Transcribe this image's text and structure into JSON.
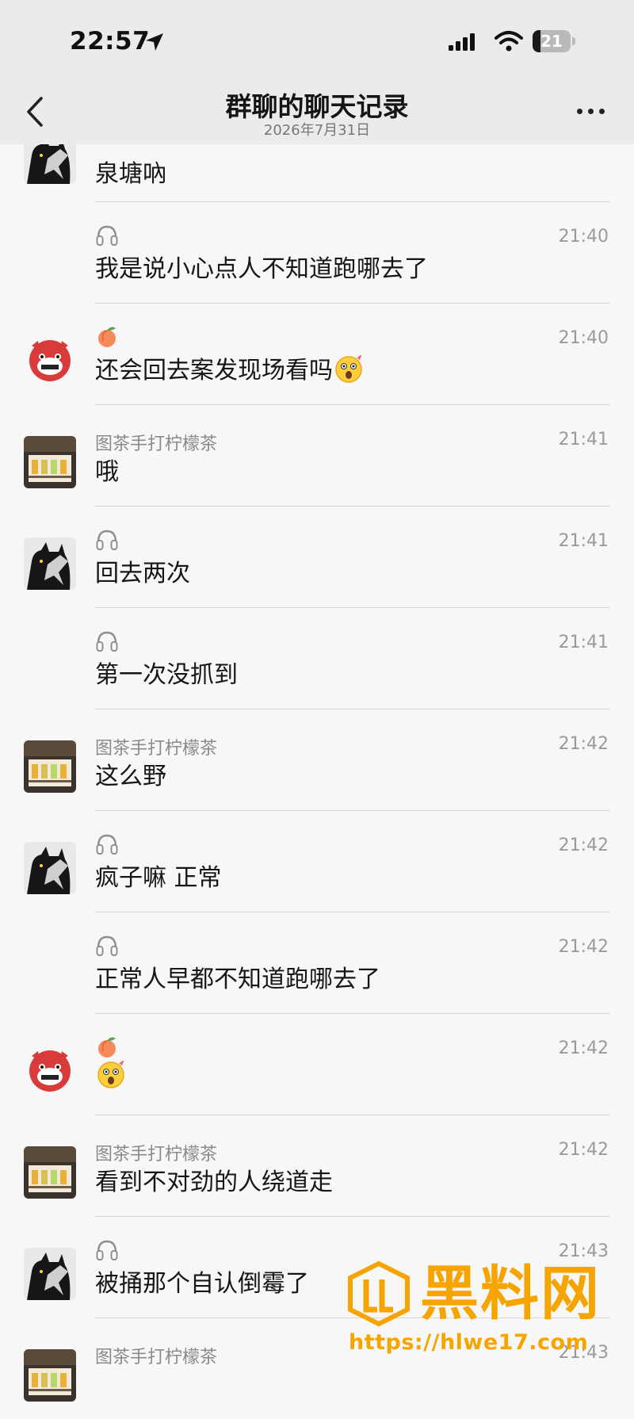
{
  "status_bar": {
    "time": "22:57",
    "battery": "21",
    "battery_level_percent": 21
  },
  "header": {
    "title": "群聊的聊天记录",
    "subtitle": "2026年7月31日"
  },
  "messages": [
    {
      "avatar": "cat-avatar",
      "icon": "",
      "sender": "",
      "time": "",
      "text": "泉塘吶",
      "emoji": ""
    },
    {
      "avatar": "",
      "icon": "headphones-icon",
      "sender": "",
      "time": "21:40",
      "text": "我是说小心点人不知道跑哪去了",
      "emoji": ""
    },
    {
      "avatar": "red-pig-avatar",
      "icon": "peach-icon",
      "sender": "",
      "time": "21:40",
      "text": "还会回去案发现场看吗",
      "emoji": "shocked-face-emoji"
    },
    {
      "avatar": "tea-shop-avatar",
      "icon": "",
      "sender": "图茶手打柠檬茶",
      "time": "21:41",
      "text": "哦",
      "emoji": ""
    },
    {
      "avatar": "cat-avatar",
      "icon": "headphones-icon",
      "sender": "",
      "time": "21:41",
      "text": "回去两次",
      "emoji": ""
    },
    {
      "avatar": "",
      "icon": "headphones-icon",
      "sender": "",
      "time": "21:41",
      "text": "第一次没抓到",
      "emoji": ""
    },
    {
      "avatar": "tea-shop-avatar",
      "icon": "",
      "sender": "图茶手打柠檬茶",
      "time": "21:42",
      "text": "这么野",
      "emoji": ""
    },
    {
      "avatar": "cat-avatar",
      "icon": "headphones-icon",
      "sender": "",
      "time": "21:42",
      "text": "疯子嘛 正常",
      "emoji": ""
    },
    {
      "avatar": "",
      "icon": "headphones-icon",
      "sender": "",
      "time": "21:42",
      "text": "正常人早都不知道跑哪去了",
      "emoji": ""
    },
    {
      "avatar": "red-pig-avatar",
      "icon": "peach-icon",
      "sender": "",
      "time": "21:42",
      "text": "",
      "emoji": "shocked-face-emoji"
    },
    {
      "avatar": "tea-shop-avatar",
      "icon": "",
      "sender": "图茶手打柠檬茶",
      "time": "21:42",
      "text": "看到不对劲的人绕道走",
      "emoji": ""
    },
    {
      "avatar": "cat-avatar",
      "icon": "headphones-icon",
      "sender": "",
      "time": "21:43",
      "text": "被捅那个自认倒霉了",
      "emoji": ""
    },
    {
      "avatar": "tea-shop-avatar",
      "icon": "",
      "sender": "图茶手打柠檬茶",
      "time": "21:43",
      "text": "",
      "emoji": ""
    }
  ],
  "watermark": {
    "title": "黑料网",
    "url": "https://hlwe17.com"
  },
  "colors": {
    "watermark": "#f5a400",
    "header_bg": "#ebebeb",
    "page_bg": "#f7f7f7"
  }
}
